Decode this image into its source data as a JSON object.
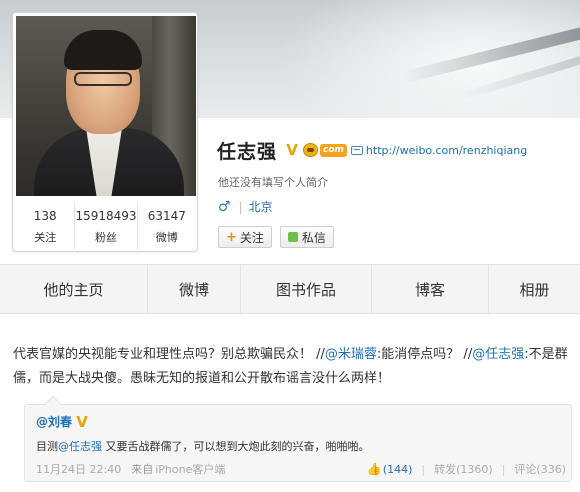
{
  "profile": {
    "name": "任志强",
    "url": "http://weibo.com/renzhiqiang",
    "com_badge": "com",
    "bio": "他还没有填写个人简介",
    "gender_icon": "♂",
    "location": "北京",
    "stats": [
      {
        "value": "138",
        "label": "关注"
      },
      {
        "value": "15918493",
        "label": "粉丝"
      },
      {
        "value": "63147",
        "label": "微博"
      }
    ],
    "follow_label": "关注",
    "message_label": "私信"
  },
  "tabs": [
    "他的主页",
    "微博",
    "图书作品",
    "博客",
    "相册"
  ],
  "post": {
    "text_1": "代表官媒的央视能专业和理性点吗？别总欺骗民众！ //",
    "mention_1": "@米瑞蓉",
    "text_2": ":能消停点吗？ //",
    "mention_2": "@任志强",
    "text_3": ":不是群儒，而是大战央傻。愚昧无知的报道和公开散布谣言没什么两样！"
  },
  "repost": {
    "author": "@刘春",
    "text_1": "目测",
    "mention": "@任志强",
    "text_2": " 又要舌战群儒了，可以想到大炮此刻的兴奋，啪啪啪。",
    "time": "11月24日 22:40",
    "from_label": "来自",
    "client": "iPhone客户端",
    "likes": "(144)",
    "reposts": "转发(1360)",
    "comments": "评论(336)"
  },
  "colors": {
    "link": "#1f6fbb",
    "verified": "#e8a400"
  }
}
